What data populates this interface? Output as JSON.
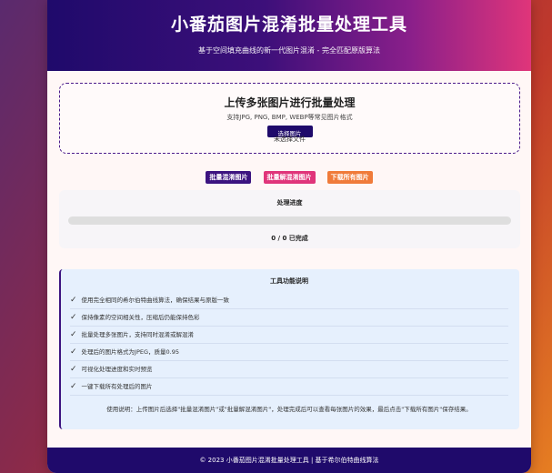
{
  "header": {
    "title": "小番茄图片混淆批量处理工具",
    "subtitle": "基于空间填充曲线的新一代图片混淆 - 完全匹配原版算法"
  },
  "upload": {
    "title": "上传多张图片进行批量处理",
    "formats": "支持JPG, PNG, BMP, WEBP等常见图片格式",
    "choose_label": "选择图片",
    "no_file": "未选择文件"
  },
  "actions": {
    "obfuscate": "批量混淆图片",
    "deobfuscate": "批量解混淆图片",
    "download": "下载所有图片"
  },
  "progress": {
    "title": "处理进度",
    "percent": 0,
    "status": "0 / 0 已完成"
  },
  "info": {
    "title": "工具功能说明",
    "items": [
      "使用完全相同的希尔伯特曲线算法，确保结果与原版一致",
      "保持像素的空间相关性，压缩后仍能保持色彩",
      "批量处理多张图片，支持同时混淆或解混淆",
      "处理后的图片格式为JPEG，质量0.95",
      "可视化处理进度和实时预览",
      "一键下载所有处理后的图片"
    ],
    "usage": "使用说明：上传图片后选择\"批量混淆图片\"或\"批量解混淆图片\"，处理完成后可以查看每张图片的效果，最后点击\"下载所有图片\"保存结果。"
  },
  "footer": {
    "text": "© 2023 小番茄图片混淆批量处理工具 | 基于希尔伯特曲线算法"
  },
  "icons": {
    "check": "✓"
  },
  "colors": {
    "primary": "#1f0a6b",
    "accent_pink": "#e0357a",
    "accent_orange": "#f07b3a"
  }
}
